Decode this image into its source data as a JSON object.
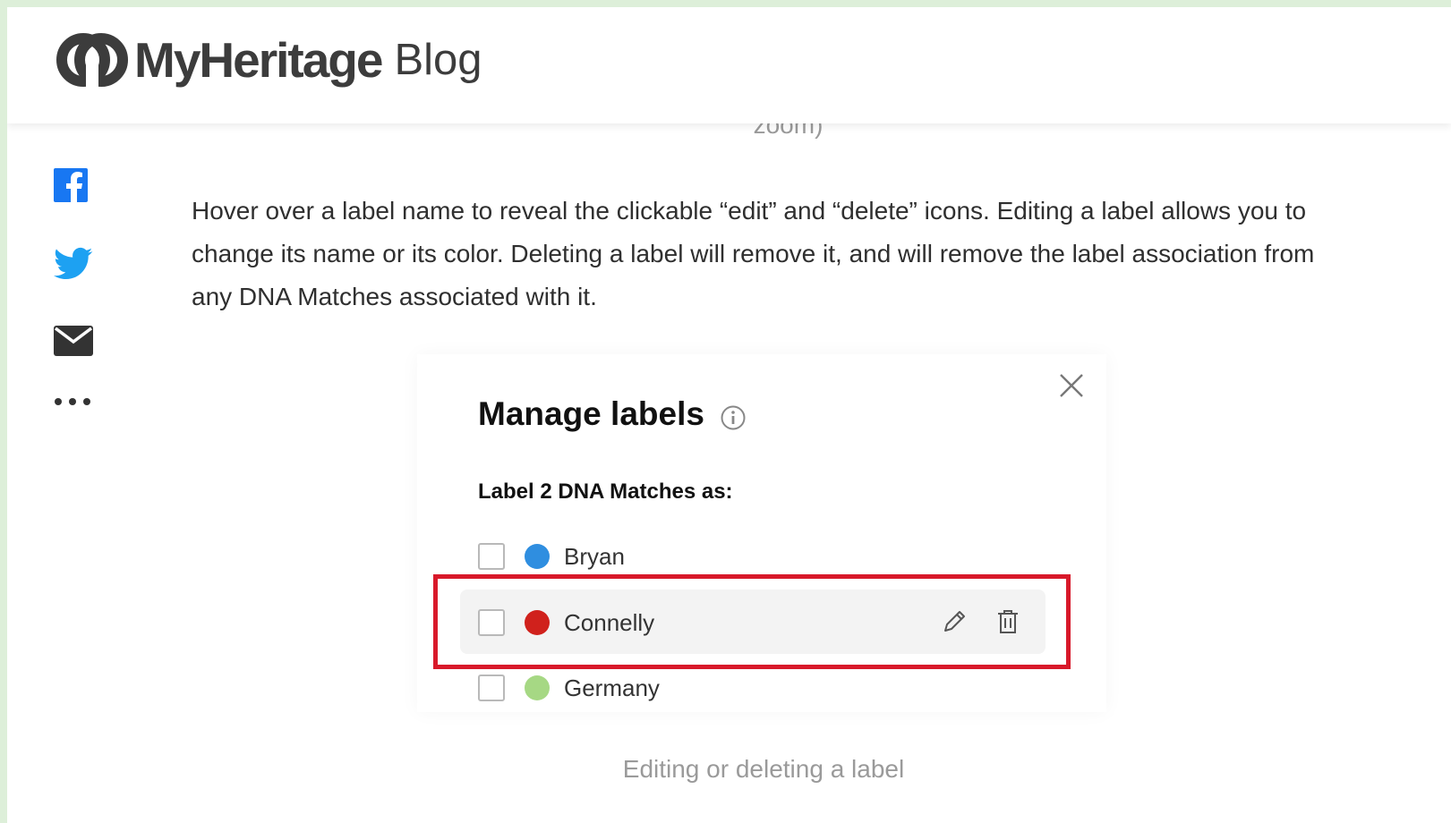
{
  "header": {
    "logo_word": "MyHeritage",
    "logo_blog": "Blog",
    "prev_caption_fragment": "zoom)"
  },
  "share": {
    "items": [
      {
        "icon": "facebook-icon",
        "color": "#1877f2"
      },
      {
        "icon": "twitter-icon",
        "color": "#1da1f2"
      },
      {
        "icon": "email-icon",
        "color": "#333333"
      },
      {
        "icon": "more-icon",
        "color": "#333333"
      }
    ]
  },
  "article": {
    "paragraph": "Hover over a label name to reveal the clickable “edit” and “delete” icons. Editing a label allows you to change its name or its color. Deleting a label will remove it, and will remove the label association from any DNA Matches associated with it."
  },
  "modal": {
    "title": "Manage labels",
    "subtitle": "Label 2 DNA Matches as:",
    "labels": [
      {
        "name": "Bryan",
        "color": "#2f8ee0",
        "checked": false
      },
      {
        "name": "Connelly",
        "color": "#d0211c",
        "checked": false,
        "hovered": true
      },
      {
        "name": "Germany",
        "color": "#a6d884",
        "checked": false
      }
    ]
  },
  "caption": "Editing or deleting a label",
  "colors": {
    "highlight": "#d8192a",
    "background_strip": "#ddefd9"
  }
}
